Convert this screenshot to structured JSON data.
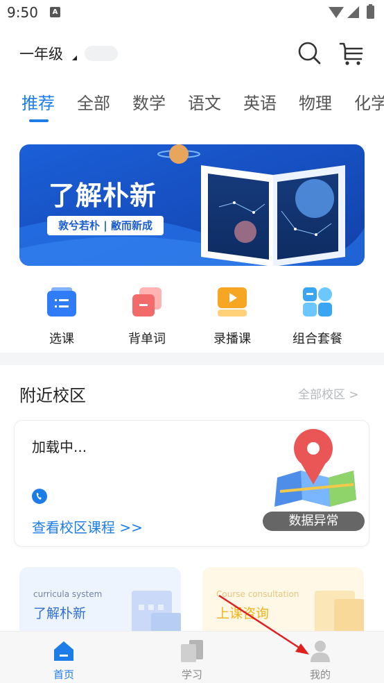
{
  "status_bar": {
    "time": "9:50",
    "notification_glyph": "A"
  },
  "header": {
    "grade": "一年级"
  },
  "tabs": [
    {
      "label": "推荐",
      "active": true
    },
    {
      "label": "全部"
    },
    {
      "label": "数学"
    },
    {
      "label": "语文"
    },
    {
      "label": "英语"
    },
    {
      "label": "物理"
    },
    {
      "label": "化学"
    }
  ],
  "banner": {
    "title": "了解朴新",
    "subtitle": "敦兮若朴 | 敝而新成"
  },
  "quick_entries": [
    {
      "label": "选课",
      "icon": "course-select-icon",
      "color": "#2f7cf6"
    },
    {
      "label": "背单词",
      "icon": "vocabulary-icon",
      "color": "#f26a6a"
    },
    {
      "label": "录播课",
      "icon": "recorded-video-icon",
      "color": "#f6a623"
    },
    {
      "label": "组合套餐",
      "icon": "bundle-package-icon",
      "color": "#3aa6f3"
    }
  ],
  "campus": {
    "title": "附近校区",
    "all_link": "全部校区 >",
    "loading_text": "加载中...",
    "course_link": "查看校区课程 >>",
    "error_badge": "数据异常"
  },
  "promos": [
    {
      "en": "curricula system",
      "cn": "了解朴新",
      "accent": "#2f6fd6"
    },
    {
      "en": "Course consultation",
      "cn": "上课咨询",
      "accent": "#f2b41a"
    }
  ],
  "bottom_nav": [
    {
      "label": "首页",
      "icon": "home-icon",
      "active": true
    },
    {
      "label": "学习",
      "icon": "study-book-icon"
    },
    {
      "label": "我的",
      "icon": "profile-icon"
    }
  ],
  "colors": {
    "accent": "#1d7de8",
    "annotation_arrow": "#e02020"
  }
}
